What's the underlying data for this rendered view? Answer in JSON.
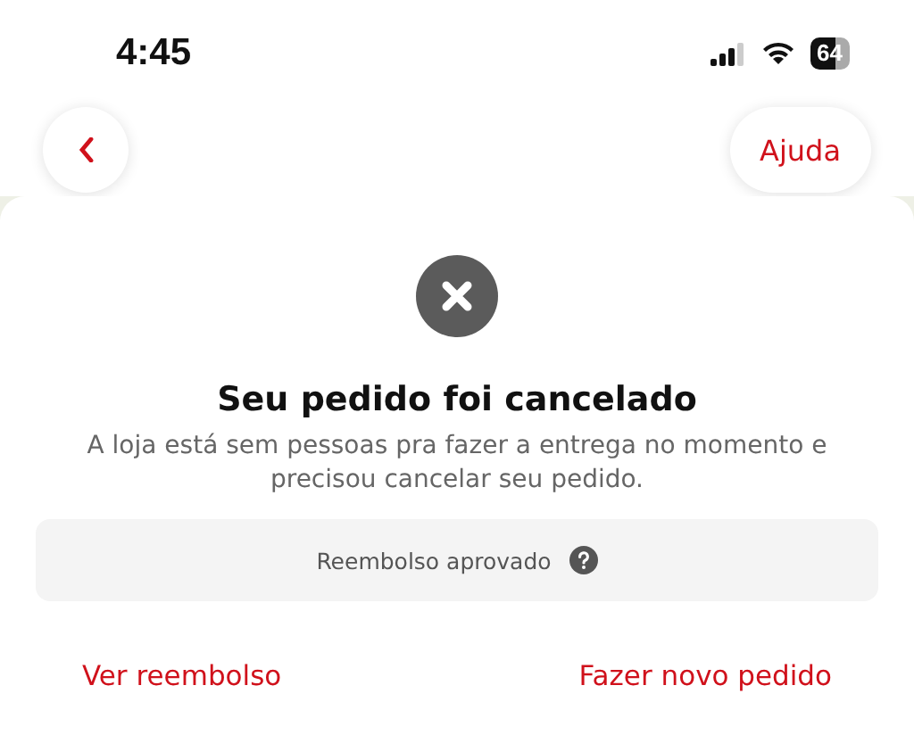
{
  "status_bar": {
    "time": "4:45",
    "battery": "64"
  },
  "nav": {
    "help": "Ajuda"
  },
  "sheet": {
    "title": "Seu pedido foi cancelado",
    "message": "A loja está sem pessoas pra fazer a entrega no momento e precisou cancelar seu pedido.",
    "refund": {
      "label": "Reembolso aprovado"
    },
    "actions": [
      {
        "label": "Ver reembolso"
      },
      {
        "label": "Fazer novo pedido"
      }
    ]
  }
}
